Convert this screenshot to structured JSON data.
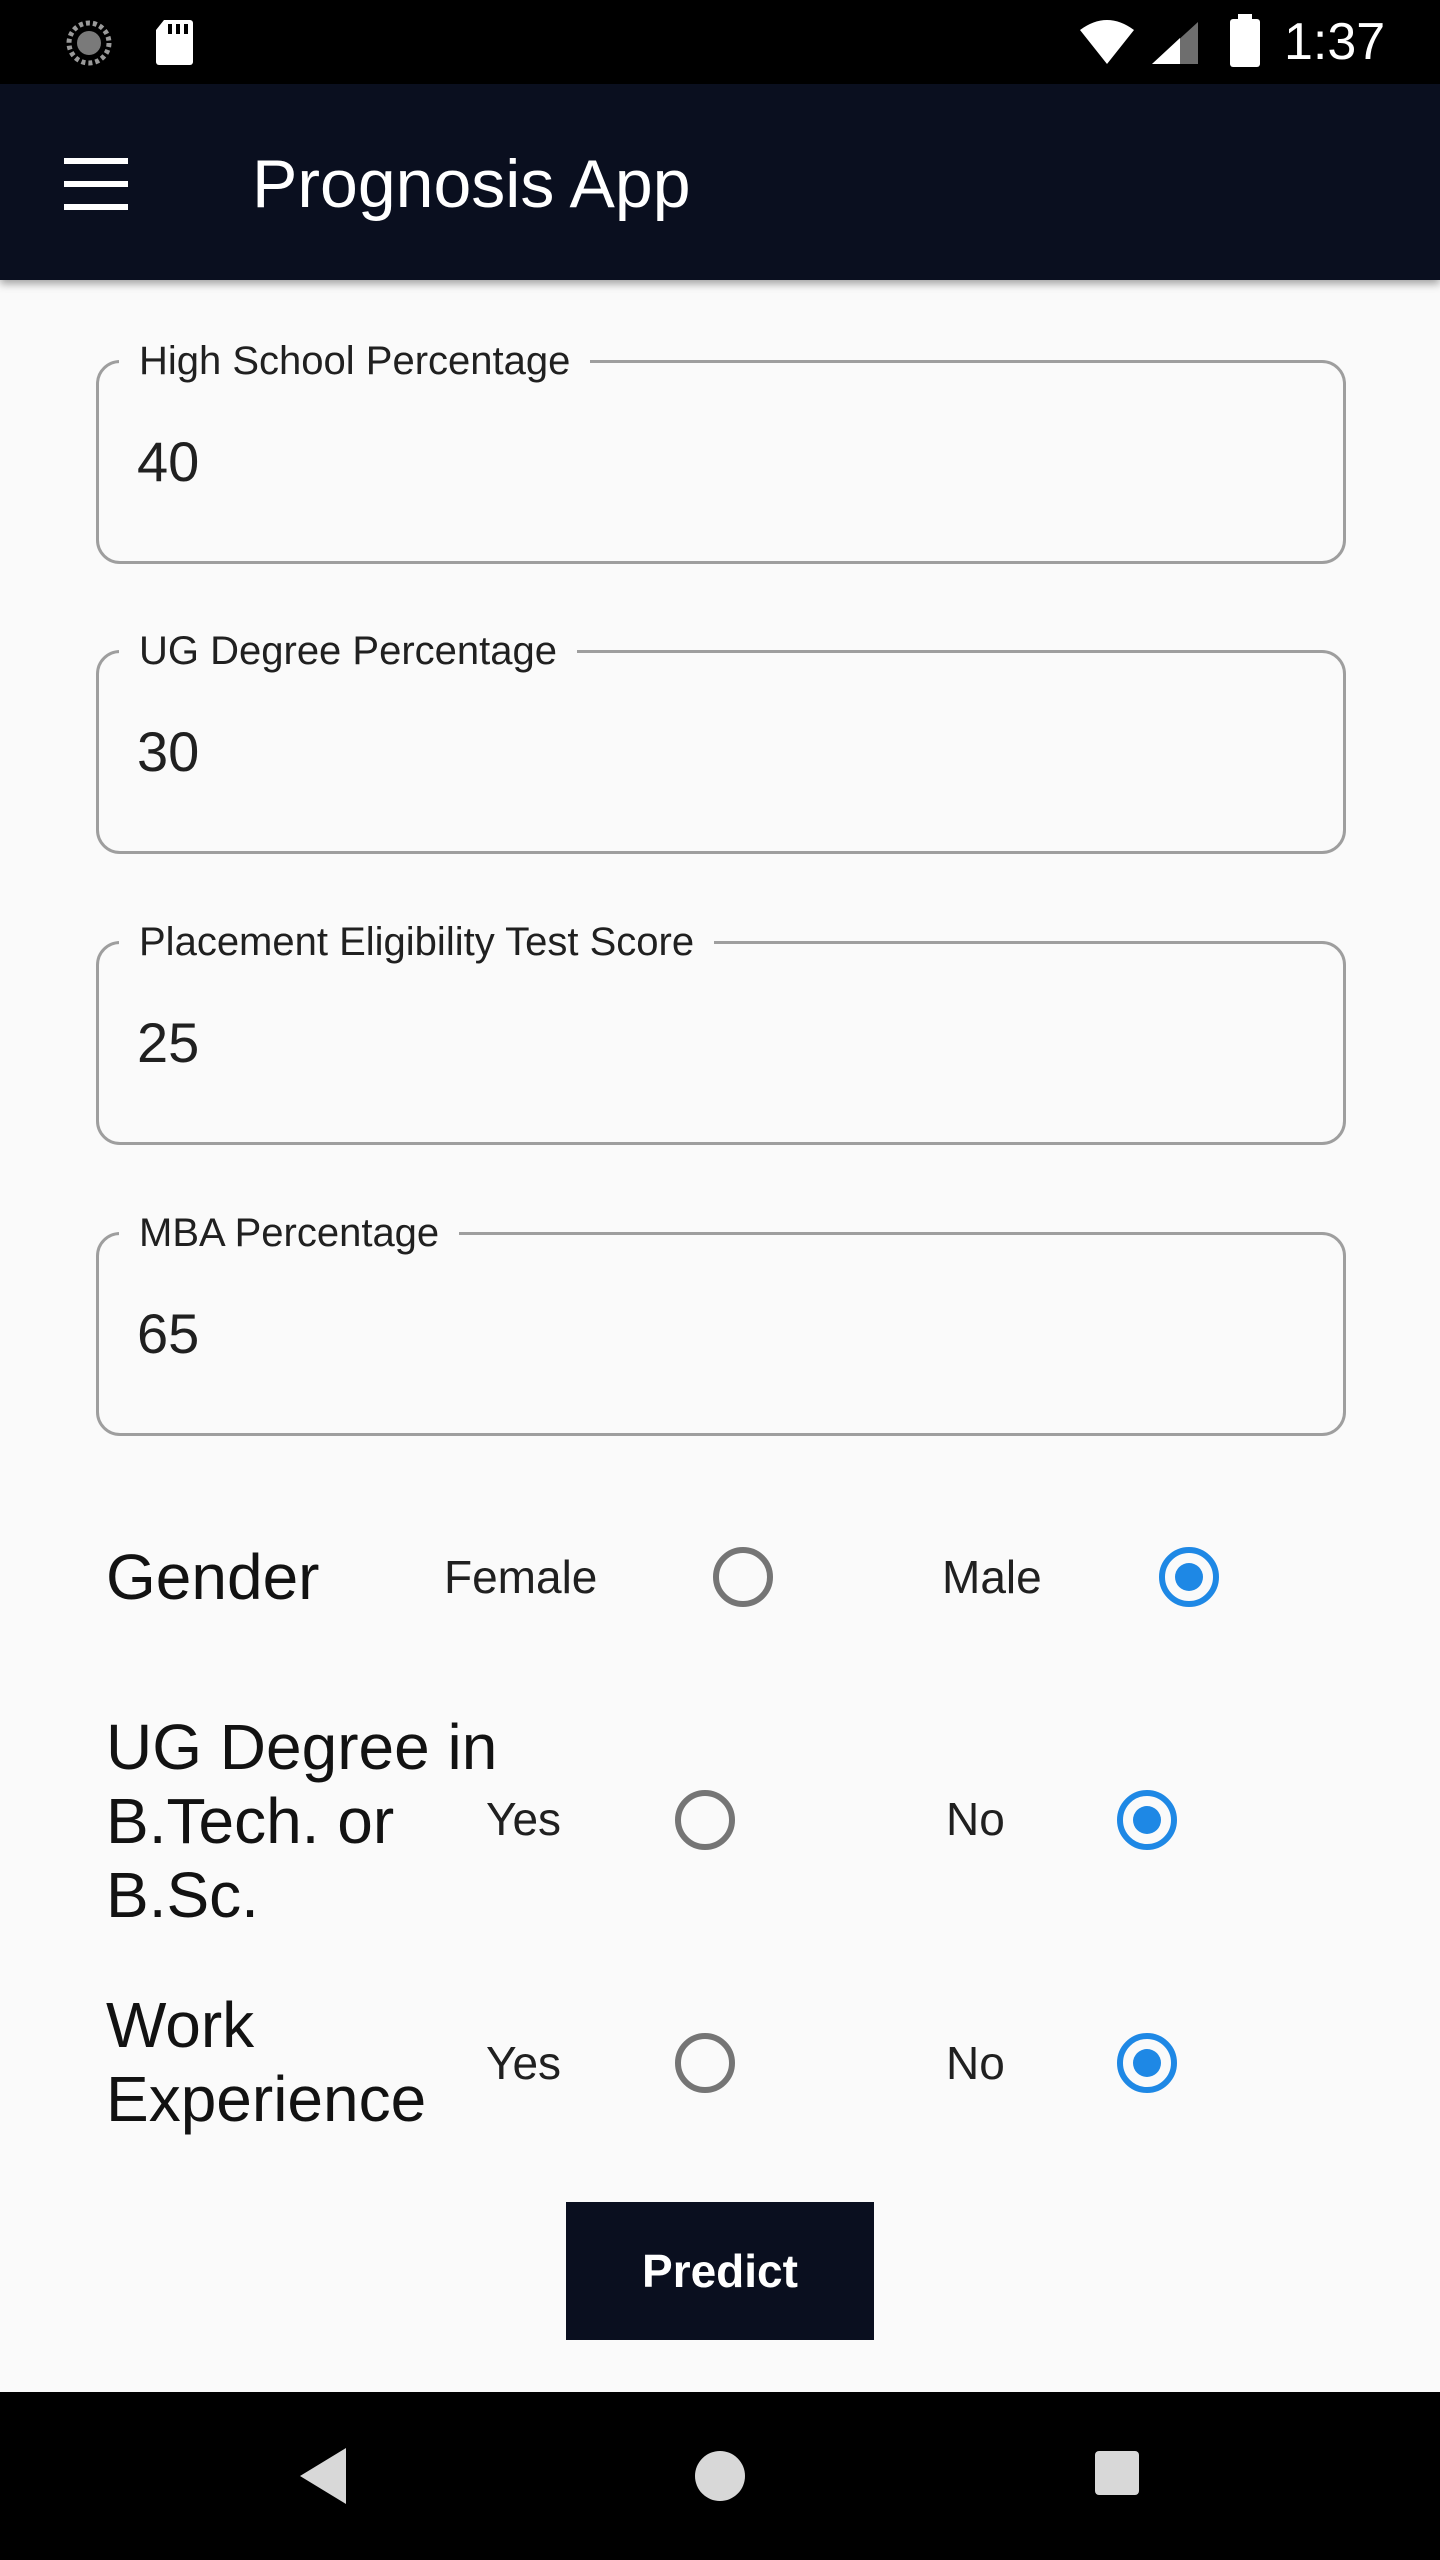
{
  "status_bar": {
    "time": "1:37",
    "icons": [
      "sync-icon",
      "sd-card-icon",
      "wifi-icon",
      "signal-icon",
      "battery-icon"
    ]
  },
  "app_bar": {
    "title": "Prognosis App",
    "menu_icon": "hamburger-menu-icon"
  },
  "form": {
    "fields": [
      {
        "label": "High School Percentage",
        "value": "40"
      },
      {
        "label": "UG Degree Percentage",
        "value": "30"
      },
      {
        "label": "Placement Eligibility Test Score",
        "value": "25"
      },
      {
        "label": "MBA Percentage",
        "value": "65"
      }
    ],
    "gender": {
      "label": "Gender",
      "options": [
        "Female",
        "Male"
      ],
      "selected": "Male"
    },
    "ug_degree": {
      "label_lines": [
        "UG Degree in",
        "B.Tech. or",
        "B.Sc."
      ],
      "options": [
        "Yes",
        "No"
      ],
      "selected": "No"
    },
    "work_experience": {
      "label_lines": [
        "Work",
        "Experience"
      ],
      "options": [
        "Yes",
        "No"
      ],
      "selected": "No"
    },
    "predict_label": "Predict"
  },
  "colors": {
    "app_bar": "#0a0f1f",
    "accent": "#1e88e5",
    "background": "#fafafa"
  },
  "nav_bar": {
    "icons": [
      "back-icon",
      "home-icon",
      "recents-icon"
    ]
  }
}
